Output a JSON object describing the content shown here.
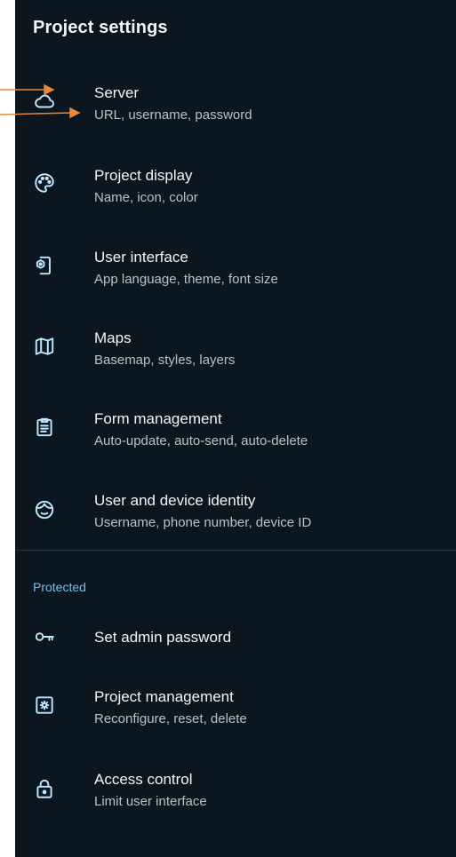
{
  "header": {
    "title": "Project settings"
  },
  "items": [
    {
      "label": "Server",
      "sub": "URL, username, password",
      "icon": "cloud-icon"
    },
    {
      "label": "Project display",
      "sub": "Name, icon, color",
      "icon": "palette-icon"
    },
    {
      "label": "User interface",
      "sub": "App language, theme, font size",
      "icon": "phone-settings-icon"
    },
    {
      "label": "Maps",
      "sub": "Basemap, styles, layers",
      "icon": "map-icon"
    },
    {
      "label": "Form management",
      "sub": "Auto-update, auto-send, auto-delete",
      "icon": "clipboard-icon"
    },
    {
      "label": "User and device identity",
      "sub": "Username, phone number, device ID",
      "icon": "face-icon"
    }
  ],
  "protected": {
    "header": "Protected",
    "items": [
      {
        "label": "Set admin password",
        "icon": "key-icon"
      },
      {
        "label": "Project management",
        "sub": "Reconfigure, reset, delete",
        "icon": "gear-box-icon"
      },
      {
        "label": "Access control",
        "sub": "Limit user interface",
        "icon": "lock-icon"
      }
    ]
  },
  "colors": {
    "background": "#0b161f",
    "icon": "#bfe7ff",
    "accent": "#6fc2ea",
    "annotation_arrow": "#e8893a"
  }
}
